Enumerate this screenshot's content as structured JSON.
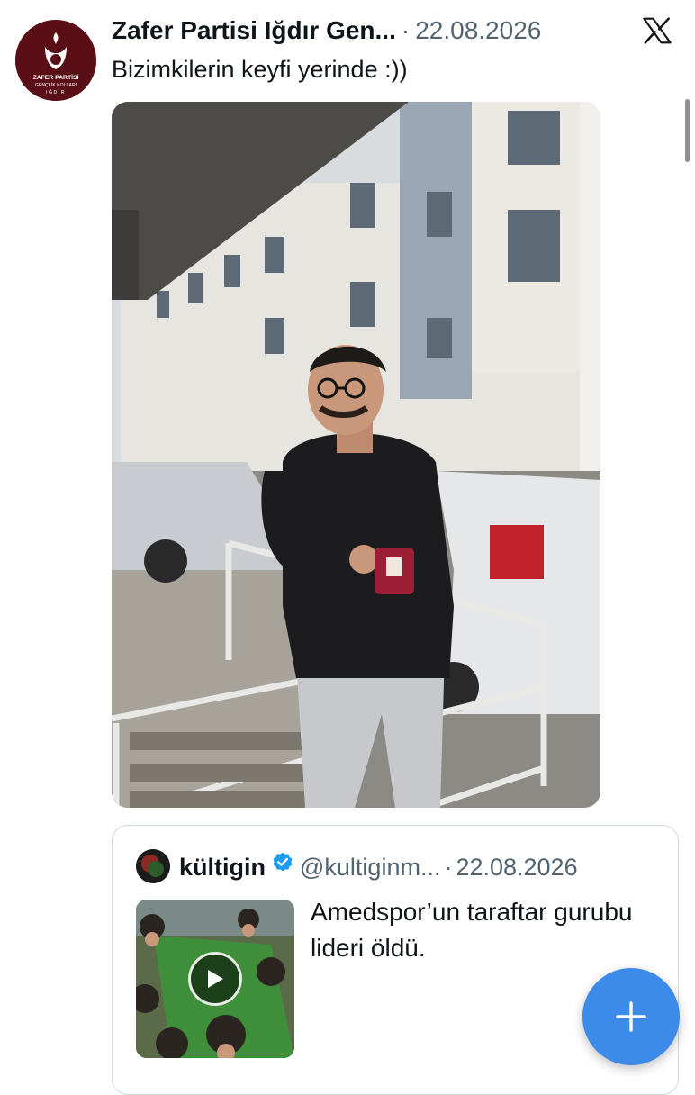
{
  "post": {
    "author_name": "Zafer Partisi Iğdır Gen...",
    "separator": "·",
    "date": "22.08.2026",
    "text": "Bizimkilerin keyfi yerinde :))",
    "avatar": {
      "line1": "ZAFER PARTİSİ",
      "line2": "GENÇLİK KOLLARI",
      "line3": "IĞDIR"
    }
  },
  "quote": {
    "name": "kültigin",
    "handle": "@kultiginm...",
    "separator": "·",
    "date": "22.08.2026",
    "text": "Amedspor’un taraftar gurubu lideri öldü."
  },
  "icons": {
    "close": "x-logo-icon",
    "verified": "verified-badge-icon",
    "play": "play-icon",
    "compose": "plus-icon"
  },
  "colors": {
    "accent": "#3d8be8",
    "verified": "#1d9bf0",
    "secondary_text": "#536471",
    "brand_avatar": "#5a0f16"
  }
}
